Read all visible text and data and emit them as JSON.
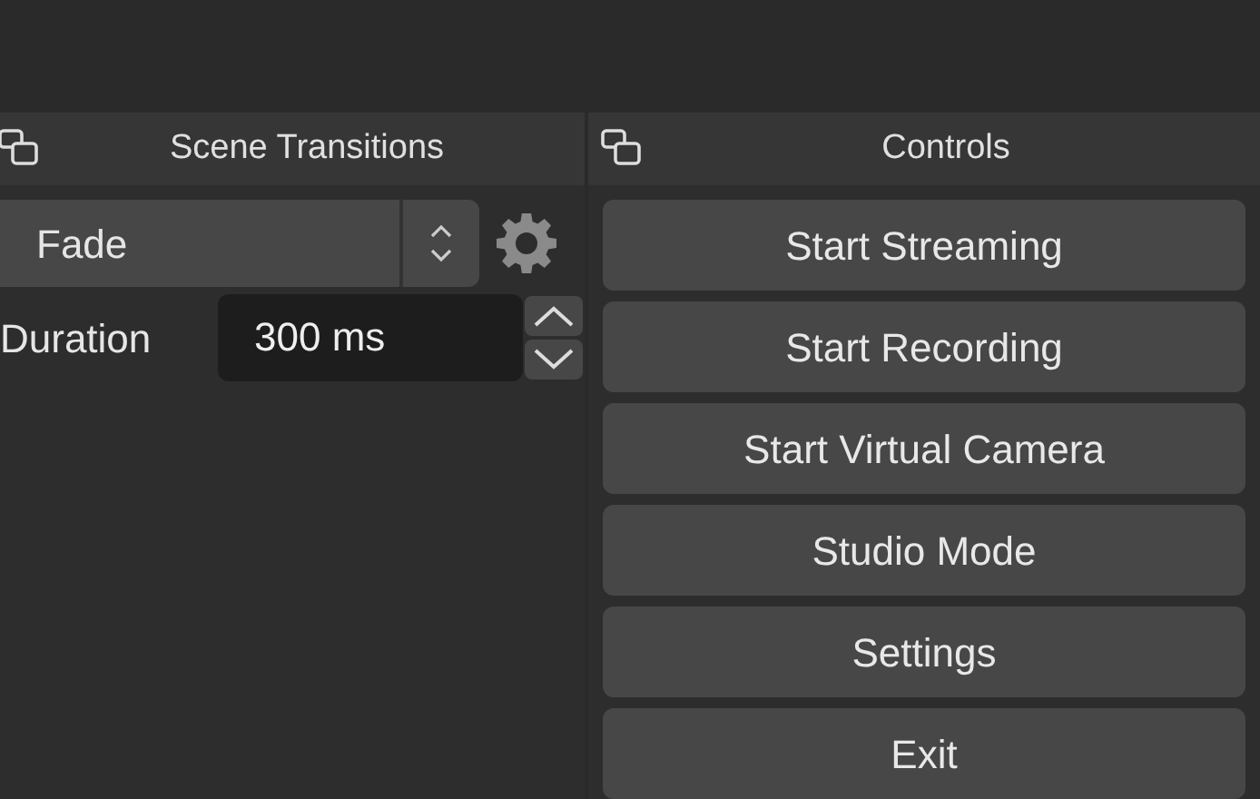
{
  "docks": [
    {
      "title": "Scene Transitions",
      "transition": {
        "value": "Fade"
      },
      "duration": {
        "label": "Duration",
        "value": "300 ms"
      }
    },
    {
      "title": "Controls",
      "buttons": [
        "Start Streaming",
        "Start Recording",
        "Start Virtual Camera",
        "Studio Mode",
        "Settings",
        "Exit"
      ]
    }
  ]
}
